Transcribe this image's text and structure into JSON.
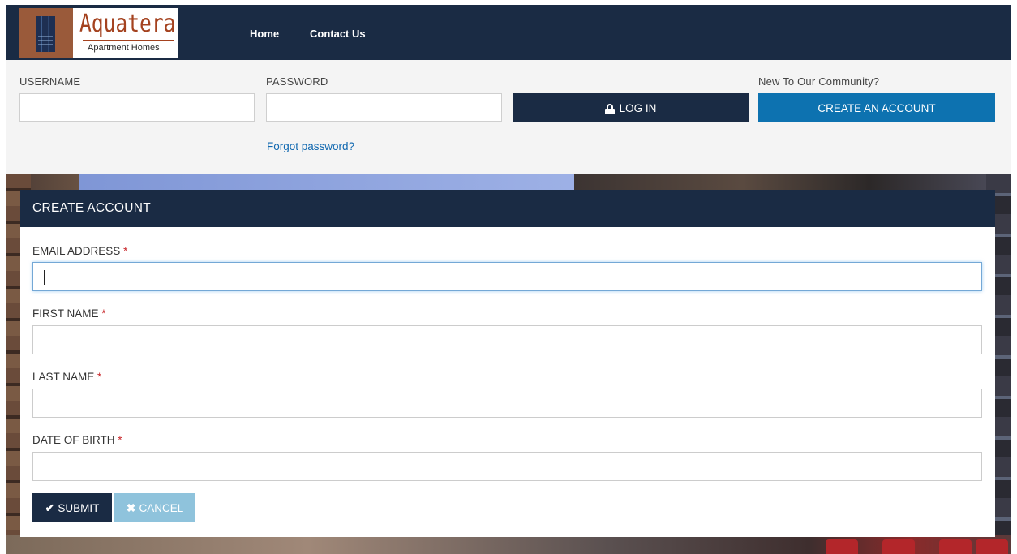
{
  "brand": {
    "name": "Aquatera",
    "tagline": "Apartment Homes"
  },
  "nav": {
    "items": [
      {
        "label": "Home"
      },
      {
        "label": "Contact Us"
      }
    ]
  },
  "login": {
    "username_label": "USERNAME",
    "username_value": "",
    "password_label": "PASSWORD",
    "password_value": "",
    "login_button": "LOG IN",
    "new_community_label": "New To Our Community?",
    "create_account_button": "CREATE AN ACCOUNT",
    "forgot_password_link": "Forgot password?"
  },
  "create_account": {
    "title": "CREATE ACCOUNT",
    "required_marker": "*",
    "fields": [
      {
        "label": "EMAIL ADDRESS",
        "value": "",
        "focused": true
      },
      {
        "label": "FIRST NAME",
        "value": ""
      },
      {
        "label": "LAST NAME",
        "value": ""
      },
      {
        "label": "DATE OF BIRTH",
        "value": ""
      }
    ],
    "submit_button": "SUBMIT",
    "cancel_button": "CANCEL"
  },
  "icons": {
    "login": "lock-icon",
    "submit": "check-icon",
    "cancel": "x-icon"
  },
  "colors": {
    "navy": "#1a2b44",
    "primary_blue": "#0d72b0",
    "cancel_light_blue": "#8fc3dc",
    "required_red": "#c8262a",
    "brand_rust": "#a4421f",
    "link_blue": "#1068b0"
  }
}
